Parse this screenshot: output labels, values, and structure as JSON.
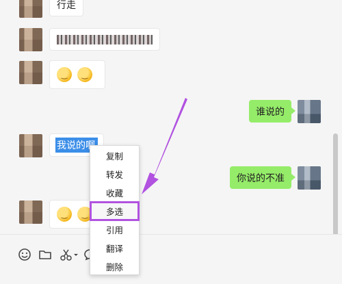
{
  "messages": [
    {
      "side": "left",
      "type": "text",
      "text": "行走"
    },
    {
      "side": "left",
      "type": "censored"
    },
    {
      "side": "left",
      "type": "emoji",
      "emojis": [
        "face-with-tears-emoji",
        "face-with-tears-emoji"
      ]
    },
    {
      "side": "right",
      "type": "text",
      "text": "谁说的"
    },
    {
      "side": "left",
      "type": "selected_text",
      "text": "我说的啊"
    },
    {
      "side": "right",
      "type": "text",
      "text": "你说的不准"
    },
    {
      "side": "left",
      "type": "emoji",
      "emojis": [
        "face-with-tears-emoji",
        "face-with-tears-emoji"
      ]
    }
  ],
  "context_menu": {
    "items": [
      {
        "label": "复制"
      },
      {
        "label": "转发"
      },
      {
        "label": "收藏"
      },
      {
        "label": "多选",
        "highlighted": true
      },
      {
        "label": "引用"
      },
      {
        "label": "翻译"
      },
      {
        "label": "删除"
      }
    ]
  },
  "toolbar": {
    "icons": [
      "emoji-icon",
      "folder-icon",
      "scissors-icon",
      "chat-history-icon"
    ]
  },
  "annotation": {
    "color": "#b152e0",
    "type": "arrow"
  },
  "colors": {
    "sent_bubble": "#95ec69",
    "received_bubble": "#ffffff",
    "selection": "#3b8ee8",
    "background": "#f5f5f5"
  }
}
